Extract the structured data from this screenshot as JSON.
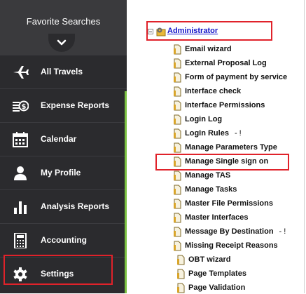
{
  "sidebar": {
    "title": "Favorite Searches",
    "items": [
      {
        "label": "All Travels",
        "icon": "airplane-icon"
      },
      {
        "label": "Expense Reports",
        "icon": "money-icon"
      },
      {
        "label": "Calendar",
        "icon": "calendar-icon"
      },
      {
        "label": "My Profile",
        "icon": "user-icon"
      },
      {
        "label": "Analysis Reports",
        "icon": "bar-chart-icon"
      },
      {
        "label": "Accounting",
        "icon": "calculator-icon"
      },
      {
        "label": "Settings",
        "icon": "gear-icon"
      }
    ],
    "colors": {
      "background": "#2b2b2e",
      "header": "#3a3a3d",
      "accent": "#7cc242",
      "highlight": "#e0222a"
    }
  },
  "tree": {
    "root_label": "Administrator",
    "items": [
      {
        "label": "Email wizard",
        "suffix": ""
      },
      {
        "label": "External Proposal Log",
        "suffix": ""
      },
      {
        "label": "Form of payment by service",
        "suffix": ""
      },
      {
        "label": "Interface check",
        "suffix": ""
      },
      {
        "label": "Interface Permissions",
        "suffix": ""
      },
      {
        "label": "Login Log",
        "suffix": ""
      },
      {
        "label": "LogIn Rules",
        "suffix": "- !"
      },
      {
        "label": "Manage Parameters Type",
        "suffix": ""
      },
      {
        "label": "Manage Single sign on",
        "suffix": ""
      },
      {
        "label": "Manage TAS",
        "suffix": ""
      },
      {
        "label": "Manage Tasks",
        "suffix": ""
      },
      {
        "label": "Master File Permissions",
        "suffix": ""
      },
      {
        "label": "Master Interfaces",
        "suffix": ""
      },
      {
        "label": "Message By Destination",
        "suffix": "- !"
      },
      {
        "label": "Missing Receipt Reasons",
        "suffix": ""
      },
      {
        "label": "OBT wizard",
        "suffix": ""
      },
      {
        "label": "Page Templates",
        "suffix": ""
      },
      {
        "label": "Page Validation",
        "suffix": ""
      }
    ],
    "colors": {
      "root_link": "#1010c8",
      "item_text": "#111111"
    }
  }
}
